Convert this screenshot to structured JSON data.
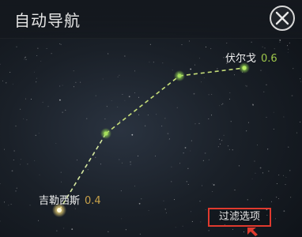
{
  "header": {
    "title": "自动导航",
    "close_icon": "close-icon"
  },
  "route": {
    "start": {
      "name": "吉勒西斯",
      "value": "0.4"
    },
    "end": {
      "name": "伏尔戈",
      "value": "0.6"
    },
    "waypoint_count": 3
  },
  "filter": {
    "label": "过滤选项"
  },
  "colors": {
    "route_line": "#c8e07a",
    "waypoint": "#8fd14f",
    "start_node": "#f7e7a0",
    "start_value": "#c9a24a",
    "end_value": "#9ec74a",
    "highlight_border": "#e03a2e"
  }
}
